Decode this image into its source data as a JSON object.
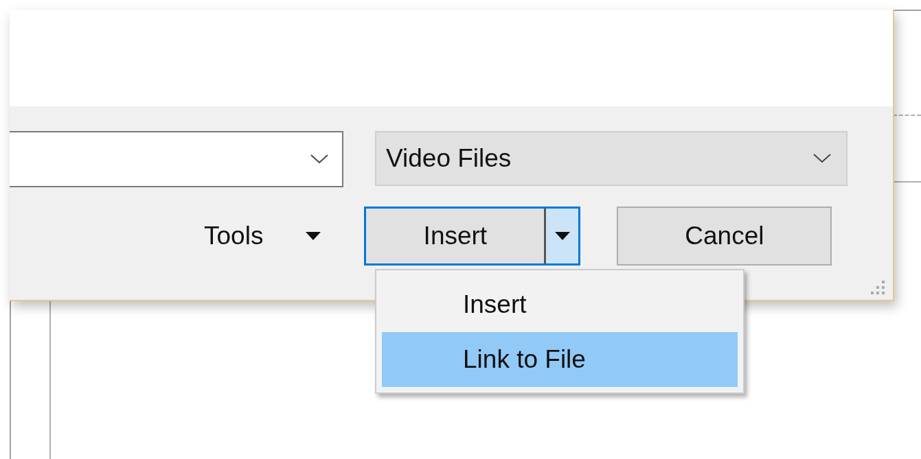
{
  "file_type": {
    "value": "Video Files"
  },
  "tools": {
    "label": "Tools"
  },
  "buttons": [
    {
      "kind": "split",
      "label": "Insert",
      "focused": true
    },
    {
      "kind": "plain",
      "label": "Cancel",
      "focused": false
    }
  ],
  "menu": {
    "items": [
      {
        "label": "Insert",
        "selected": false
      },
      {
        "label": "Link to File",
        "selected": true
      }
    ]
  }
}
